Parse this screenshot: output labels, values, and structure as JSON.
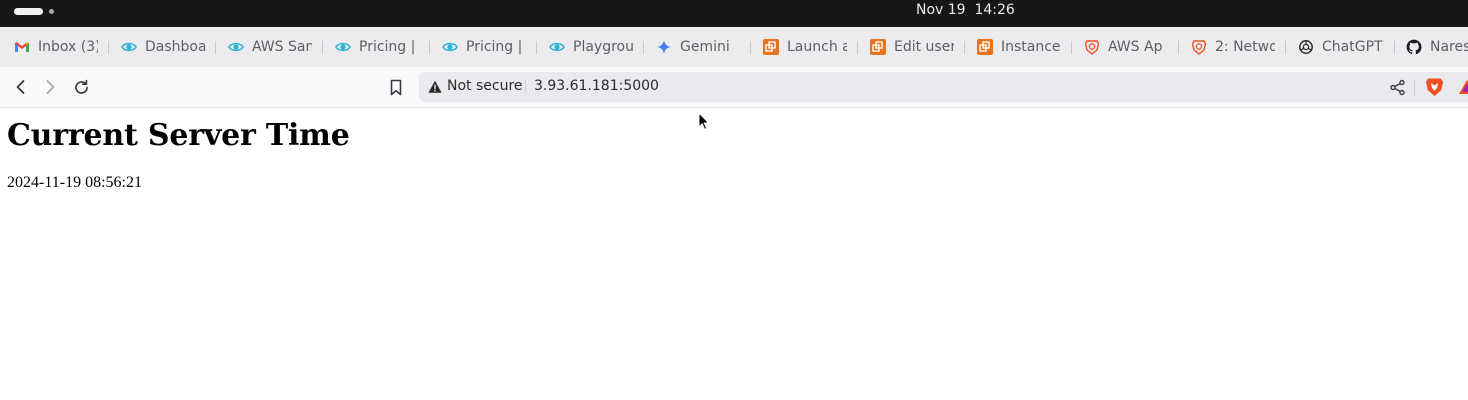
{
  "system_bar": {
    "clock": "Nov 19  14:26"
  },
  "bookmarks": [
    {
      "label": "Inbox (3)",
      "icon": "gmail-icon"
    },
    {
      "label": "Dashboa",
      "icon": "eye-icon"
    },
    {
      "label": "AWS San",
      "icon": "eye-icon"
    },
    {
      "label": "Pricing |",
      "icon": "eye-icon"
    },
    {
      "label": "Pricing |",
      "icon": "eye-icon"
    },
    {
      "label": "Playgrou",
      "icon": "eye-icon"
    },
    {
      "label": "Gemini",
      "icon": "gemini-icon"
    },
    {
      "label": "Launch a",
      "icon": "aws-ec2-icon"
    },
    {
      "label": "Edit user",
      "icon": "aws-ec2-icon"
    },
    {
      "label": "Instance",
      "icon": "aws-ec2-icon"
    },
    {
      "label": "AWS Ap",
      "icon": "brave-q-icon"
    },
    {
      "label": "2: Netwo",
      "icon": "brave-q-icon"
    },
    {
      "label": "ChatGPT",
      "icon": "openai-icon"
    },
    {
      "label": "Nares",
      "icon": "github-icon"
    }
  ],
  "toolbar": {
    "security_label": "Not secure",
    "url": "3.93.61.181:5000"
  },
  "page": {
    "heading": "Current Server Time",
    "time": "2024-11-19 08:56:21"
  },
  "colors": {
    "system_bar": "#171717",
    "bookmarks_bar": "#ececee",
    "omnibox": "#eaeaee",
    "eye_icon": "#2fb4d8",
    "gmail_red": "#ea4335",
    "aws_orange": "#e8731a",
    "brave_orange": "#f04e23"
  }
}
